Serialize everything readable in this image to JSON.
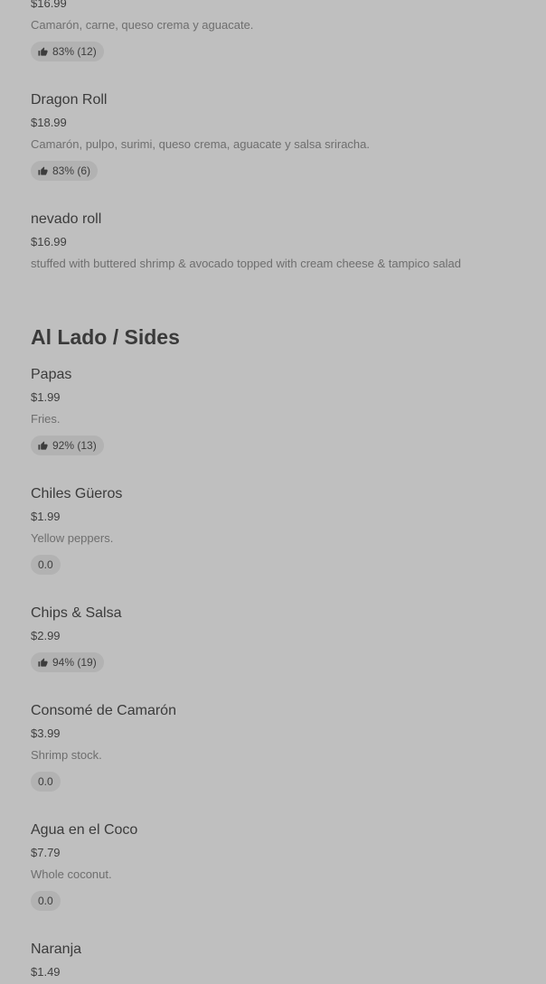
{
  "items_top": [
    {
      "price": "$16.99",
      "description": "Camarón, carne, queso crema y aguacate.",
      "rating": "83% (12)"
    },
    {
      "name": "Dragon Roll",
      "price": "$18.99",
      "description": "Camarón, pulpo, surimi, queso crema, aguacate y salsa sriracha.",
      "rating": "83% (6)"
    },
    {
      "name": "nevado roll",
      "price": "$16.99",
      "description": "stuffed with buttered shrimp & avocado topped with cream cheese & tampico salad"
    }
  ],
  "sides": {
    "title": "Al Lado / Sides",
    "items": [
      {
        "name": "Papas",
        "price": "$1.99",
        "description": "Fries.",
        "rating": "92% (13)"
      },
      {
        "name": "Chiles Güeros",
        "price": "$1.99",
        "description": "Yellow peppers.",
        "rating": "0.0"
      },
      {
        "name": "Chips & Salsa",
        "price": "$2.99",
        "rating": "94% (19)"
      },
      {
        "name": "Consomé de Camarón",
        "price": "$3.99",
        "description": "Shrimp stock.",
        "rating": "0.0"
      },
      {
        "name": "Agua en el Coco",
        "price": "$7.79",
        "description": "Whole coconut.",
        "rating": "0.0"
      },
      {
        "name": "Naranja",
        "price": "$1.49"
      }
    ]
  },
  "icons": {
    "thumb": "thumbs-up-icon"
  }
}
